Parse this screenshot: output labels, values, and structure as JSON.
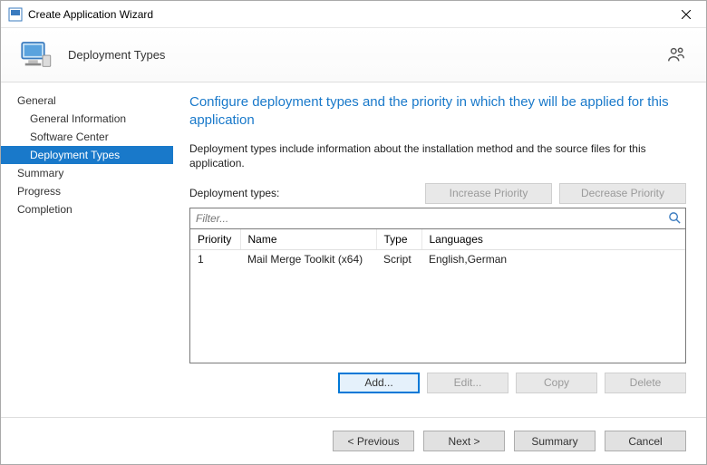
{
  "window": {
    "title": "Create Application Wizard"
  },
  "banner": {
    "subtitle": "Deployment Types"
  },
  "sidebar": {
    "general": "General",
    "general_info": "General Information",
    "software_center": "Software Center",
    "deployment_types": "Deployment Types",
    "summary": "Summary",
    "progress": "Progress",
    "completion": "Completion"
  },
  "content": {
    "headline": "Configure deployment types and the priority in which they will be applied for this application",
    "description": "Deployment types include information about the installation method and the source files for this application.",
    "dt_label": "Deployment types:",
    "increase_priority": "Increase Priority",
    "decrease_priority": "Decrease Priority",
    "filter_placeholder": "Filter...",
    "columns": {
      "priority": "Priority",
      "name": "Name",
      "type": "Type",
      "languages": "Languages"
    },
    "rows": [
      {
        "priority": "1",
        "name": "Mail Merge Toolkit (x64)",
        "type": "Script",
        "languages": "English,German"
      }
    ],
    "add": "Add...",
    "edit": "Edit...",
    "copy": "Copy",
    "delete": "Delete"
  },
  "footer": {
    "previous": "< Previous",
    "next": "Next >",
    "summary": "Summary",
    "cancel": "Cancel"
  }
}
